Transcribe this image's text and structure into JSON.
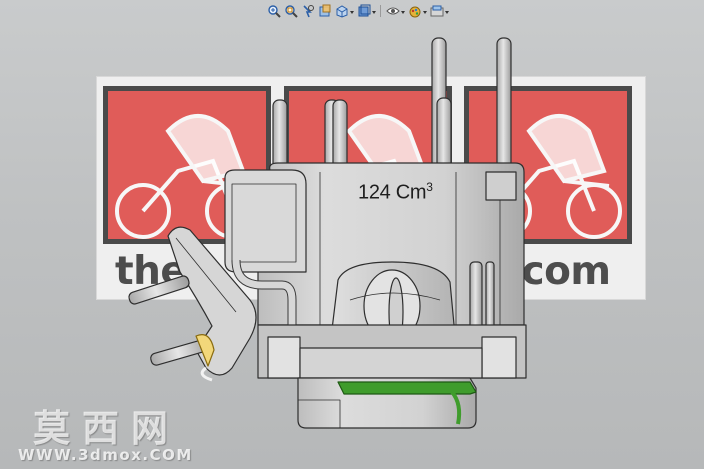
{
  "toolbar": {
    "items": [
      {
        "name": "zoom-to-fit-icon"
      },
      {
        "name": "zoom-to-area-icon"
      },
      {
        "name": "previous-view-icon"
      },
      {
        "name": "section-view-icon"
      },
      {
        "name": "view-orientation-icon",
        "dropdown": true
      },
      {
        "name": "display-style-icon",
        "dropdown": true
      },
      {
        "name": "hide-show-items-icon",
        "dropdown": true
      },
      {
        "name": "edit-appearance-icon",
        "dropdown": true
      },
      {
        "name": "apply-scene-icon",
        "dropdown": true
      }
    ]
  },
  "banner": {
    "url_left": "thet",
    "url_right": "t.com"
  },
  "model": {
    "displacement_number": "124 Cm",
    "displacement_unit_power": "3"
  },
  "watermark": {
    "chinese": "莫西网",
    "url": "WWW.3dmox.COM"
  },
  "colors": {
    "viewport_background": "#c0c2c3",
    "decal_red": "#e05c59",
    "model_gray": "#d5d5d5",
    "gasket_green": "#3c9a2a",
    "edge_lines": "#303030"
  }
}
